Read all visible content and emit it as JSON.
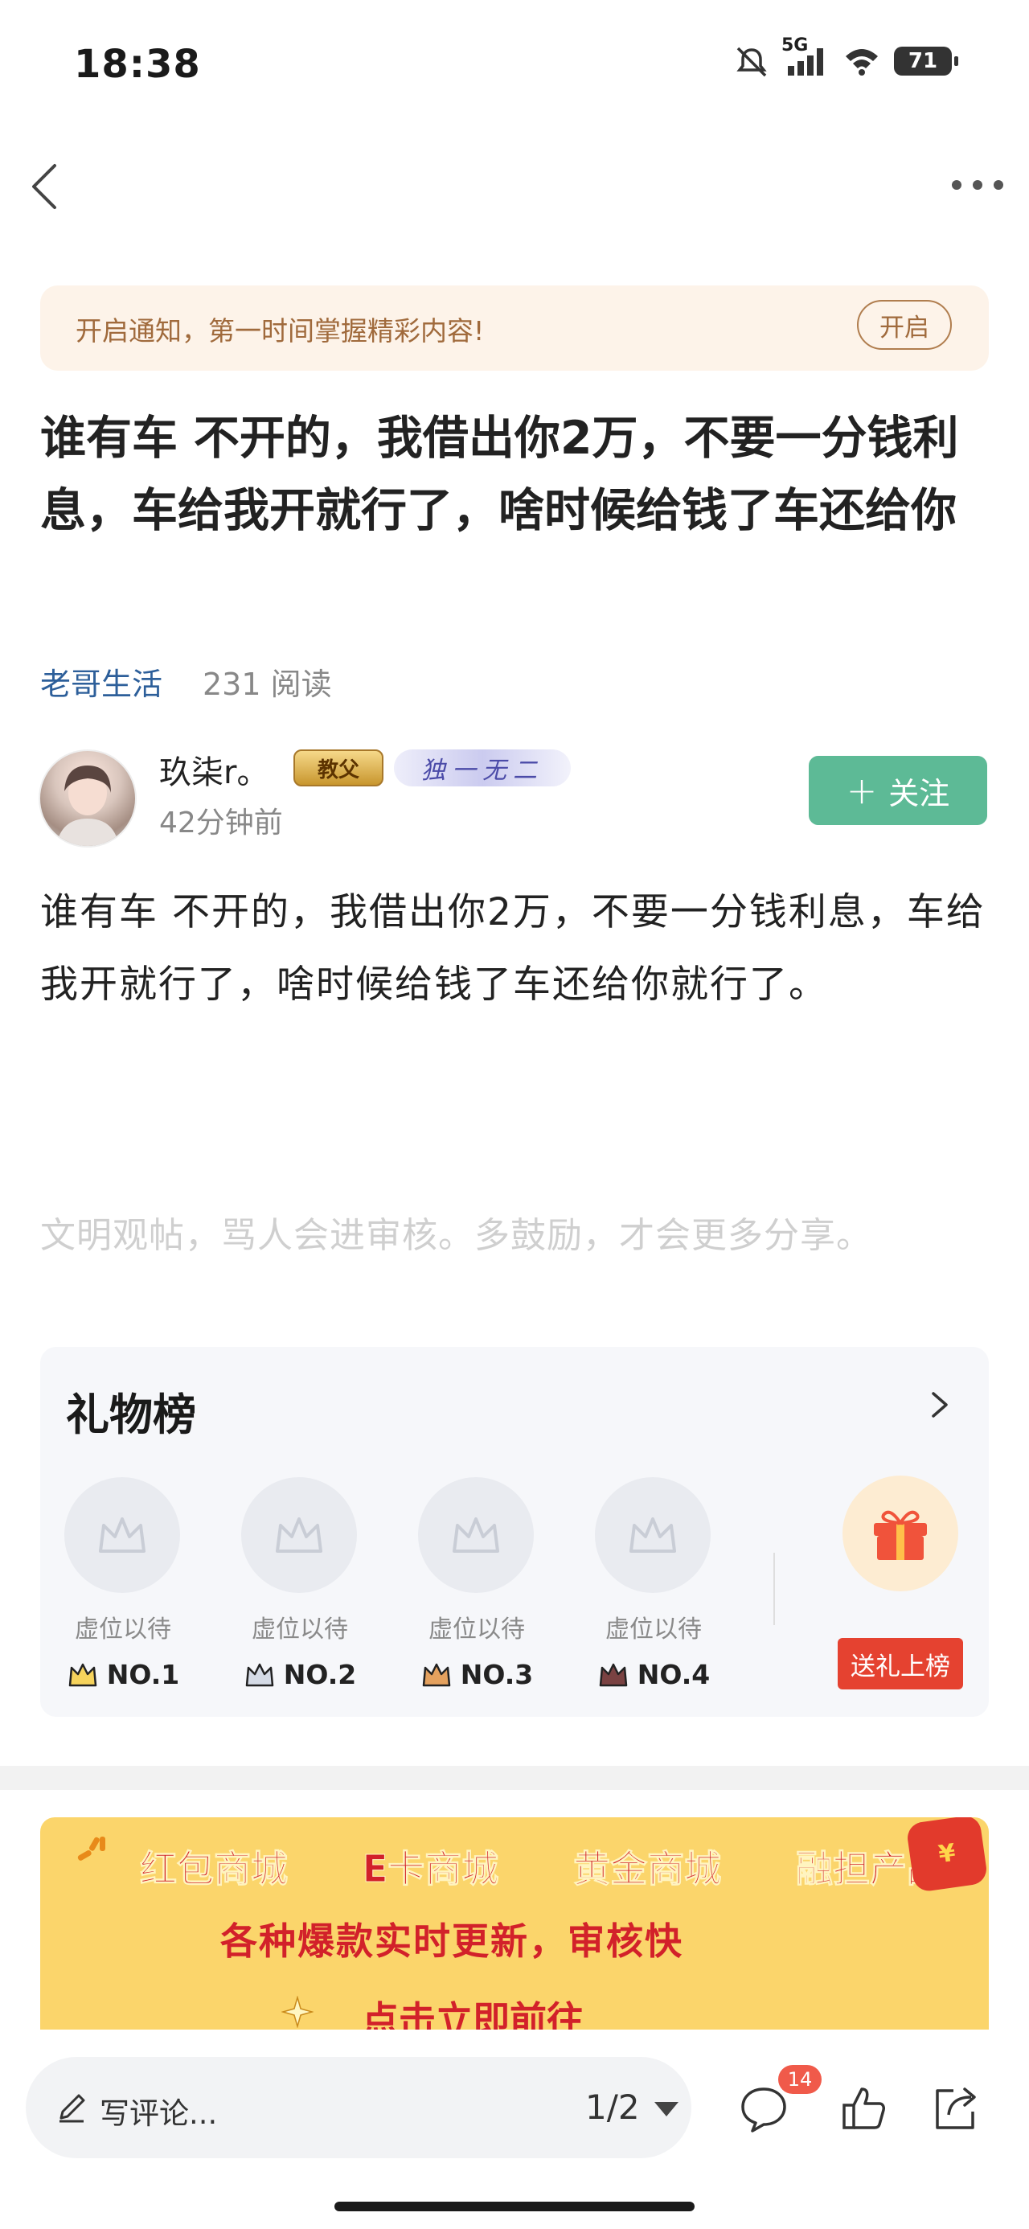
{
  "status": {
    "time": "18:38",
    "network": "5G",
    "battery": "71"
  },
  "notice": {
    "text": "开启通知，第一时间掌握精彩内容!",
    "button": "开启"
  },
  "post": {
    "title": "谁有车 不开的，我借出你2万，不要一分钱利息，车给我开就行了，啥时候给钱了车还给你",
    "source": "老哥生活",
    "reads": "231 阅读",
    "author": {
      "name": "玖柒r。",
      "medal": "教父",
      "badge": "独一无二",
      "time": "42分钟前"
    },
    "follow_label": "关注",
    "content": "谁有车 不开的，我借出你2万，不要一分钱利息，车给我开就行了，啥时候给钱了车还给你就行了。"
  },
  "hint": "文明观帖，骂人会进审核。多鼓励，才会更多分享。",
  "gift_board": {
    "title": "礼物榜",
    "slots": [
      {
        "wait": "虚位以待",
        "rank": "NO.1"
      },
      {
        "wait": "虚位以待",
        "rank": "NO.2"
      },
      {
        "wait": "虚位以待",
        "rank": "NO.3"
      },
      {
        "wait": "虚位以待",
        "rank": "NO.4"
      }
    ],
    "send_button": "送礼上榜",
    "crown_colors": [
      "#e8b62a",
      "#9aa3b5",
      "#c9813f",
      "#6b3a3a"
    ]
  },
  "banner": {
    "items": [
      "红包商城",
      "E卡商城",
      "黄金商城",
      "融担产品"
    ],
    "line2": "各种爆款实时更新，审核快",
    "line3": "点击立即前往"
  },
  "bottom": {
    "comment_placeholder": "写评论...",
    "pager": "1/2",
    "comment_count": "14"
  },
  "colors": {
    "accent": "#5dba96",
    "link": "#2d5f9a",
    "red": "#e54230"
  }
}
